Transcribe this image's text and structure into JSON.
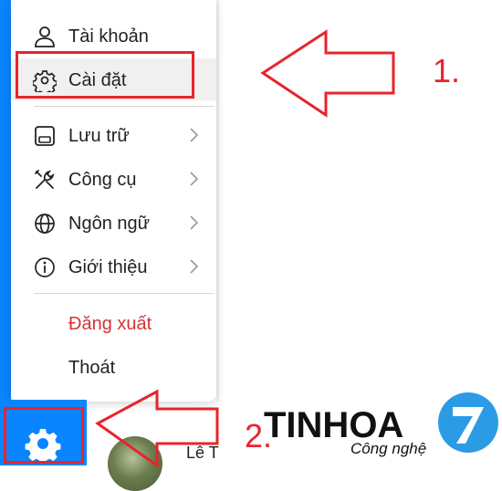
{
  "menu": {
    "items": [
      {
        "label": "Tài khoản",
        "icon": "user-icon"
      },
      {
        "label": "Cài đặt",
        "icon": "gear-icon"
      },
      {
        "label": "Lưu trữ",
        "icon": "storage-icon"
      },
      {
        "label": "Công cụ",
        "icon": "tools-icon"
      },
      {
        "label": "Ngôn ngữ",
        "icon": "globe-icon"
      },
      {
        "label": "Giới thiệu",
        "icon": "info-icon"
      },
      {
        "label": "Đăng xuất"
      },
      {
        "label": "Thoát"
      }
    ]
  },
  "annotations": {
    "step1": "1.",
    "step2": "2."
  },
  "user": {
    "name": "Lê T"
  },
  "logo": {
    "text": "TINHOA",
    "sub": "Công nghệ"
  },
  "colors": {
    "accent": "#0a84ff",
    "annotation": "#e8242c",
    "logout": "#d03535"
  }
}
